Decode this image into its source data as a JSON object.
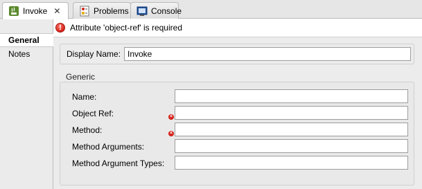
{
  "tabs": [
    {
      "label": "Invoke",
      "icon": "java-bean-icon",
      "active": true,
      "closable": true
    },
    {
      "label": "Problems",
      "icon": "problems-icon",
      "active": false
    },
    {
      "label": "Console",
      "icon": "console-icon",
      "active": false
    }
  ],
  "banner": {
    "message": "Attribute 'object-ref' is required",
    "icon": "error-icon"
  },
  "sidebar": {
    "items": [
      {
        "label": "General",
        "active": true
      },
      {
        "label": "Notes",
        "active": false
      }
    ]
  },
  "display_name": {
    "label": "Display Name:",
    "value": "Invoke"
  },
  "generic": {
    "title": "Generic",
    "fields": [
      {
        "label": "Name:",
        "value": "",
        "error": false
      },
      {
        "label": "Object Ref:",
        "value": "",
        "error": true
      },
      {
        "label": "Method:",
        "value": "",
        "error": true
      },
      {
        "label": "Method Arguments:",
        "value": "",
        "error": false
      },
      {
        "label": "Method Argument Types:",
        "value": "",
        "error": false
      }
    ]
  },
  "colors": {
    "error": "#d3231a",
    "panel": "#ececec",
    "tabbar": "#e6e6e6"
  }
}
